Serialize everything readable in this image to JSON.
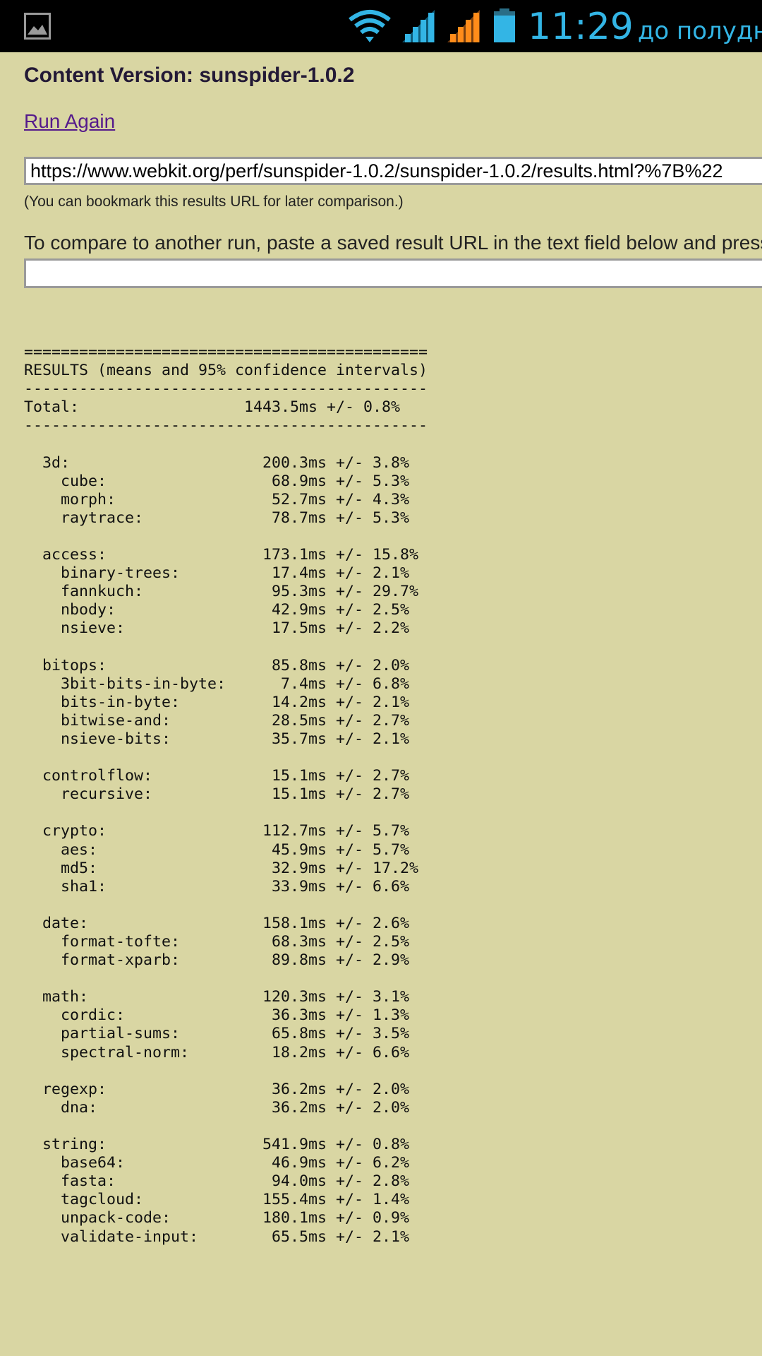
{
  "status_bar": {
    "time": "11:29",
    "ampm": "до полудня",
    "icons": [
      "gallery-notification-icon",
      "wifi-icon",
      "signal-icon",
      "signal-roaming-icon",
      "battery-icon"
    ],
    "colors": {
      "background": "#000000",
      "accent": "#33b5e5",
      "signal2": "#ff8c1a"
    }
  },
  "page": {
    "content_version": "Content Version: sunspider-1.0.2",
    "run_again": "Run Again",
    "results_url": "https://www.webkit.org/perf/sunspider-1.0.2/sunspider-1.0.2/results.html?%7B%22",
    "bookmark_note": "(You can bookmark this results URL for later comparison.)",
    "compare_text": "To compare to another run, paste a saved result URL in the text field below and press",
    "compare_value": "",
    "background": "#d9d6a3"
  },
  "results": {
    "separator_top": "============================================",
    "heading": "RESULTS (means and 95% confidence intervals)",
    "separator_dash": "--------------------------------------------",
    "total": {
      "label": "Total:",
      "time": "1443.5ms",
      "ci": "0.8%"
    },
    "groups": [
      {
        "name": "3d",
        "time": "200.3ms",
        "ci": "3.8%",
        "tests": [
          {
            "name": "cube",
            "time": "68.9ms",
            "ci": "5.3%"
          },
          {
            "name": "morph",
            "time": "52.7ms",
            "ci": "4.3%"
          },
          {
            "name": "raytrace",
            "time": "78.7ms",
            "ci": "5.3%"
          }
        ]
      },
      {
        "name": "access",
        "time": "173.1ms",
        "ci": "15.8%",
        "tests": [
          {
            "name": "binary-trees",
            "time": "17.4ms",
            "ci": "2.1%"
          },
          {
            "name": "fannkuch",
            "time": "95.3ms",
            "ci": "29.7%"
          },
          {
            "name": "nbody",
            "time": "42.9ms",
            "ci": "2.5%"
          },
          {
            "name": "nsieve",
            "time": "17.5ms",
            "ci": "2.2%"
          }
        ]
      },
      {
        "name": "bitops",
        "time": "85.8ms",
        "ci": "2.0%",
        "tests": [
          {
            "name": "3bit-bits-in-byte",
            "time": "7.4ms",
            "ci": "6.8%"
          },
          {
            "name": "bits-in-byte",
            "time": "14.2ms",
            "ci": "2.1%"
          },
          {
            "name": "bitwise-and",
            "time": "28.5ms",
            "ci": "2.7%"
          },
          {
            "name": "nsieve-bits",
            "time": "35.7ms",
            "ci": "2.1%"
          }
        ]
      },
      {
        "name": "controlflow",
        "time": "15.1ms",
        "ci": "2.7%",
        "tests": [
          {
            "name": "recursive",
            "time": "15.1ms",
            "ci": "2.7%"
          }
        ]
      },
      {
        "name": "crypto",
        "time": "112.7ms",
        "ci": "5.7%",
        "tests": [
          {
            "name": "aes",
            "time": "45.9ms",
            "ci": "5.7%"
          },
          {
            "name": "md5",
            "time": "32.9ms",
            "ci": "17.2%"
          },
          {
            "name": "sha1",
            "time": "33.9ms",
            "ci": "6.6%"
          }
        ]
      },
      {
        "name": "date",
        "time": "158.1ms",
        "ci": "2.6%",
        "tests": [
          {
            "name": "format-tofte",
            "time": "68.3ms",
            "ci": "2.5%"
          },
          {
            "name": "format-xparb",
            "time": "89.8ms",
            "ci": "2.9%"
          }
        ]
      },
      {
        "name": "math",
        "time": "120.3ms",
        "ci": "3.1%",
        "tests": [
          {
            "name": "cordic",
            "time": "36.3ms",
            "ci": "1.3%"
          },
          {
            "name": "partial-sums",
            "time": "65.8ms",
            "ci": "3.5%"
          },
          {
            "name": "spectral-norm",
            "time": "18.2ms",
            "ci": "6.6%"
          }
        ]
      },
      {
        "name": "regexp",
        "time": "36.2ms",
        "ci": "2.0%",
        "tests": [
          {
            "name": "dna",
            "time": "36.2ms",
            "ci": "2.0%"
          }
        ]
      },
      {
        "name": "string",
        "time": "541.9ms",
        "ci": "0.8%",
        "tests": [
          {
            "name": "base64",
            "time": "46.9ms",
            "ci": "6.2%"
          },
          {
            "name": "fasta",
            "time": "94.0ms",
            "ci": "2.8%"
          },
          {
            "name": "tagcloud",
            "time": "155.4ms",
            "ci": "1.4%"
          },
          {
            "name": "unpack-code",
            "time": "180.1ms",
            "ci": "0.9%"
          },
          {
            "name": "validate-input",
            "time": "65.5ms",
            "ci": "2.1%"
          }
        ]
      }
    ]
  }
}
